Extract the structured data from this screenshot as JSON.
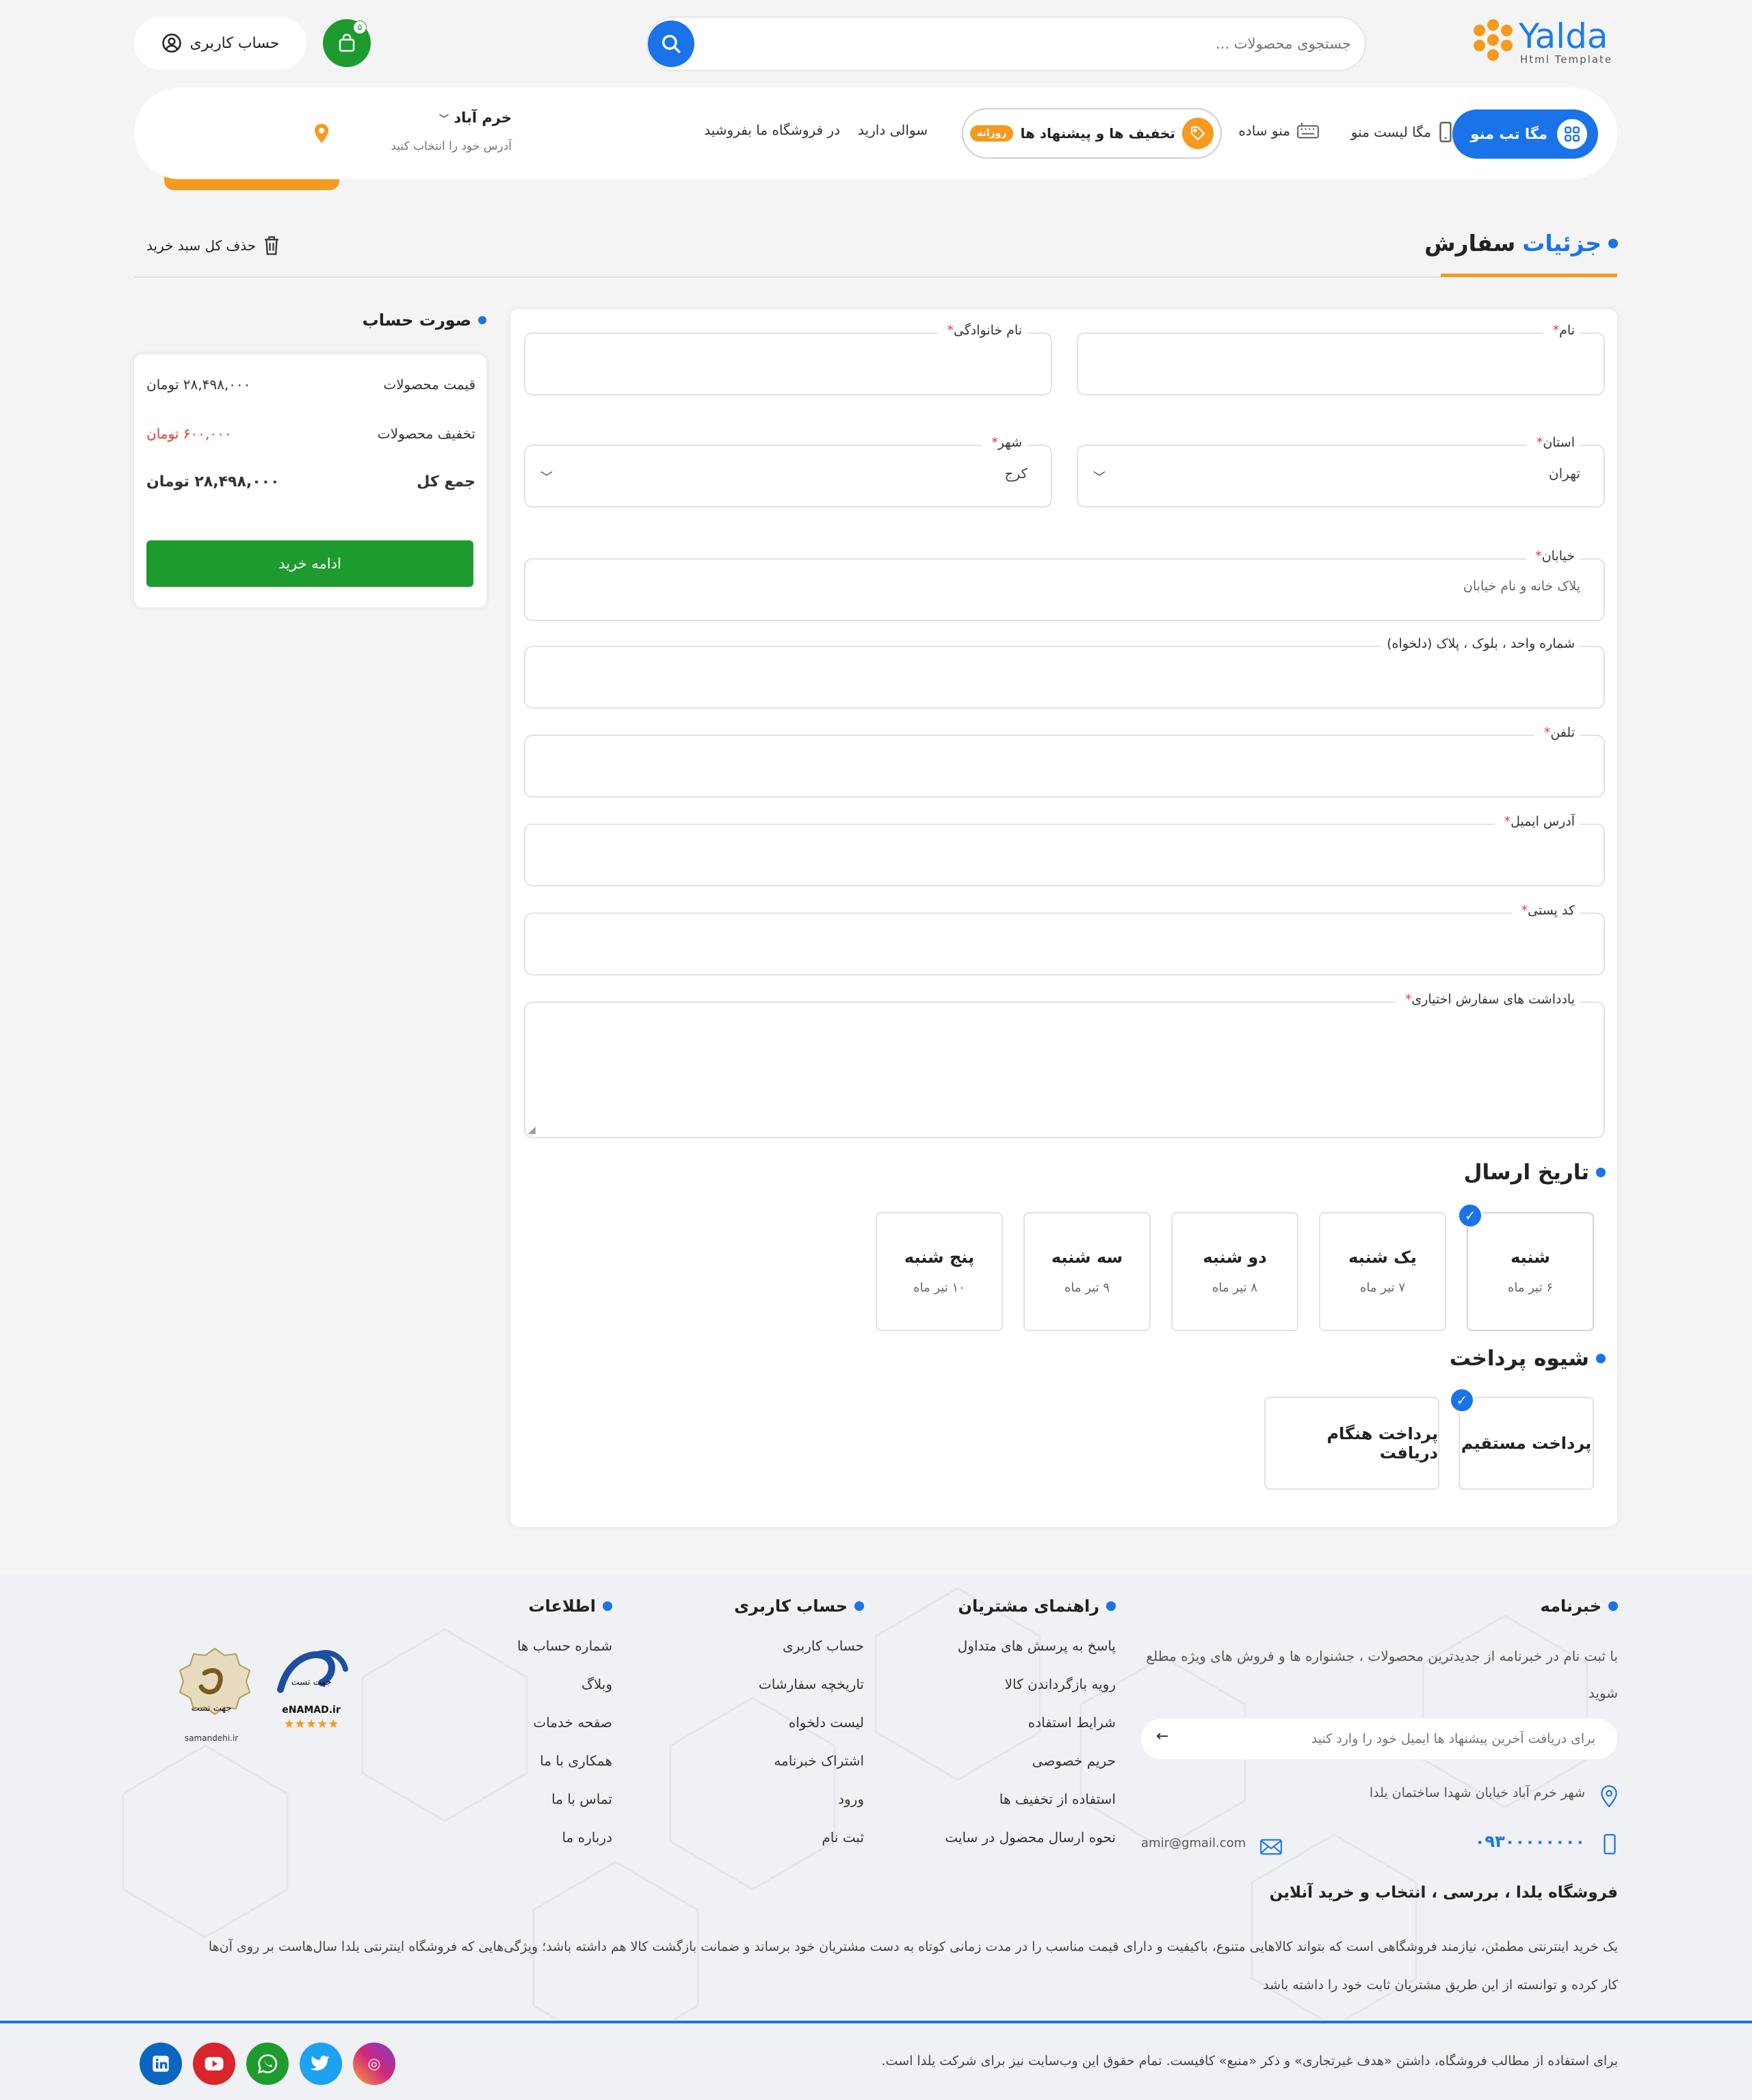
{
  "header": {
    "logo_text": "Yalda",
    "logo_sub": "Html Template",
    "search_placeholder": "جستجوی محصولات ...",
    "cart_count": "۵",
    "account_label": "حساب کاربری"
  },
  "nav": {
    "megatab": "مگا تب منو",
    "megalist": "مگا لیست منو",
    "simple": "منو ساده",
    "offers": "تخفیف ها و پیشنهاد ها",
    "offers_badge": "روزانه",
    "question": "سوالی دارید",
    "sell": "در فروشگاه ما بفروشید",
    "city": "خرم آباد",
    "city_sub": "آدرس خود را انتخاب کنید"
  },
  "page": {
    "title_blue": "جزئیات",
    "title_black": "سفارش",
    "delete_all": "حذف کل سبد خرید"
  },
  "form": {
    "first_name": {
      "label": "نام",
      "required": "*"
    },
    "last_name": {
      "label": "نام خانوادگی",
      "required": "*"
    },
    "province": {
      "label": "استان",
      "required": "*",
      "value": "تهران"
    },
    "city": {
      "label": "شهر",
      "required": "*",
      "value": "کرج"
    },
    "street": {
      "label": "خیابان",
      "required": "*",
      "placeholder": "پلاک خانه و نام خیابان"
    },
    "unit": {
      "label": "شماره واحد ، بلوک ، پلاک (دلخواه)"
    },
    "phone": {
      "label": "تلفن",
      "required": "*"
    },
    "email": {
      "label": "آدرس ایمیل",
      "required": "*"
    },
    "postal": {
      "label": "کد پستی",
      "required": "*"
    },
    "notes": {
      "label": "یادداشت های سفارش اختیاری",
      "required": "*"
    }
  },
  "delivery": {
    "title": "تاریخ ارسال",
    "days": [
      {
        "name": "شنبه",
        "date": "۶ تیر ماه",
        "selected": true
      },
      {
        "name": "یک شنبه",
        "date": "۷ تیر ماه",
        "selected": false
      },
      {
        "name": "دو شنبه",
        "date": "۸ تیر ماه",
        "selected": false
      },
      {
        "name": "سه شنبه",
        "date": "۹ تیر ماه",
        "selected": false
      },
      {
        "name": "پنج شنبه",
        "date": "۱۰ تیر ماه",
        "selected": false
      }
    ]
  },
  "payment": {
    "title": "شیوه پرداخت",
    "options": [
      {
        "label": "پرداخت مستقیم",
        "selected": true
      },
      {
        "label": "پرداخت هنگام دریافت",
        "selected": false
      }
    ]
  },
  "summary": {
    "title": "صورت حساب",
    "price_label": "قیمت محصولات",
    "price_value": "۲۸,۴۹۸,۰۰۰ تومان",
    "discount_label": "تخفیف محصولات",
    "discount_value": "۶۰۰,۰۰۰ تومان",
    "total_label": "جمع کل",
    "total_value": "۲۸,۴۹۸,۰۰۰ تومان",
    "button": "ادامه خرید"
  },
  "footer": {
    "newsletter_title": "خبرنامه",
    "newsletter_text": "با ثبت نام در خبرنامه از جدیدترین محصولات ، جشنواره ها و فروش های ویژه مطلع شوید",
    "email_placeholder": "برای دریافت آخرین پیشنهاد ها ایمیل خود را وارد کنید",
    "address": "شهر خرم آباد خیابان شهدا ساختمان یلدا",
    "phone": "۰۹۳۰۰۰۰۰۰۰۰",
    "email": "amir@gmail.com",
    "guide_title": "راهنمای مشتریان",
    "guide": [
      "پاسخ به پرسش های متداول",
      "رویه بازگرداندن کالا",
      "شرایط استفاده",
      "حریم خصوصی",
      "استفاده از تخفیف ها",
      "نحوه ارسال محصول در سایت"
    ],
    "account_title": "حساب کاربری",
    "account": [
      "حساب کاربری",
      "تاریخچه سفارشات",
      "لیست دلخواه",
      "اشتراک خبرنامه",
      "ورود",
      "ثبت نام"
    ],
    "info_title": "اطلاعات",
    "info": [
      "شماره حساب ها",
      "وبلاگ",
      "صفحه خدمات",
      "همکاری با ما",
      "تماس با ما",
      "درباره ما"
    ],
    "about_title": "فروشگاه یلدا ، بررسی ، انتخاب و خرید آنلاین",
    "about_1": "یک خرید اینترنتی مطمئن، نیازمند فروشگاهی است که بتواند کالاهایی متنوع، باکیفیت و دارای قیمت مناسب را در مدت زمانی کوتاه به دست مشتریان خود برساند و ضمانت بازگشت کالا هم داشته باشد؛ ویژگی‌هایی که فروشگاه اینترنتی یلدا سال‌هاست بر روی آن‌ها",
    "about_2": "کار کرده و توانسته از این طریق مشتریان ثابت خود را داشته باشد",
    "copyright": "برای استفاده از مطالب فروشگاه، داشتن «هدف غیرتجاری» و ذکر «منبع» کافیست. تمام حقوق این وب‌سایت نیز برای شرکت یلدا است.",
    "enamad": "eNAMAD.ir",
    "enamad_sub": "جهت تست",
    "samandehi": "samandehi.ir",
    "samandehi_sub": "جهت تست"
  },
  "colors": {
    "primary": "#1a73e8",
    "accent": "#f59a1f",
    "success": "#1e9b2f",
    "danger": "#e53935"
  }
}
